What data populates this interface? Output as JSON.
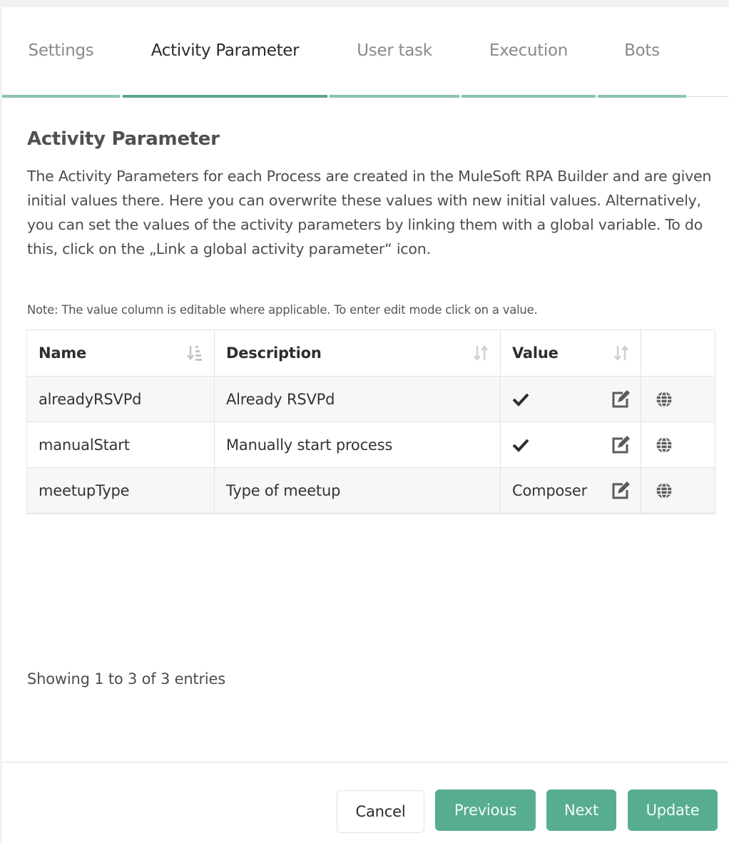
{
  "tabs": [
    {
      "label": "Settings",
      "active": false
    },
    {
      "label": "Activity Parameter",
      "active": true
    },
    {
      "label": "User task",
      "active": false
    },
    {
      "label": "Execution",
      "active": false
    },
    {
      "label": "Bots",
      "active": false
    }
  ],
  "section": {
    "title": "Activity Parameter",
    "description": "The Activity Parameters for each Process are created in the MuleSoft RPA Builder and are given initial values there. Here you can overwrite these values with new initial values. Alternatively, you can set the values of the activity parameters by linking them with a global variable. To do this, click on the „Link a global activity parameter“ icon.",
    "note": "Note: The value column is editable where applicable. To enter edit mode click on a value."
  },
  "table": {
    "columns": [
      {
        "label": "Name",
        "sort": "sort-ascending-icon"
      },
      {
        "label": "Description",
        "sort": "sort-both-icon"
      },
      {
        "label": "Value",
        "sort": "sort-both-icon"
      },
      {
        "label": ""
      }
    ],
    "rows": [
      {
        "name": "alreadyRSVPd",
        "description": "Already RSVPd",
        "value": "",
        "value_icon": "check-icon",
        "edit_icon": "edit-icon",
        "link_icon": "globe-icon"
      },
      {
        "name": "manualStart",
        "description": "Manually start process",
        "value": "",
        "value_icon": "check-icon",
        "edit_icon": "edit-icon",
        "link_icon": "globe-icon"
      },
      {
        "name": "meetupType",
        "description": "Type of meetup",
        "value": "Composer",
        "value_icon": "",
        "edit_icon": "edit-icon",
        "link_icon": "globe-icon"
      }
    ],
    "info": "Showing 1 to 3 of 3 entries"
  },
  "footer": {
    "cancel_label": "Cancel",
    "previous_label": "Previous",
    "next_label": "Next",
    "update_label": "Update"
  },
  "colors": {
    "accent": "#57ad92",
    "tab_active_bar": "#5ba58b",
    "tab_inactive_bar": "#8cc4b0"
  }
}
